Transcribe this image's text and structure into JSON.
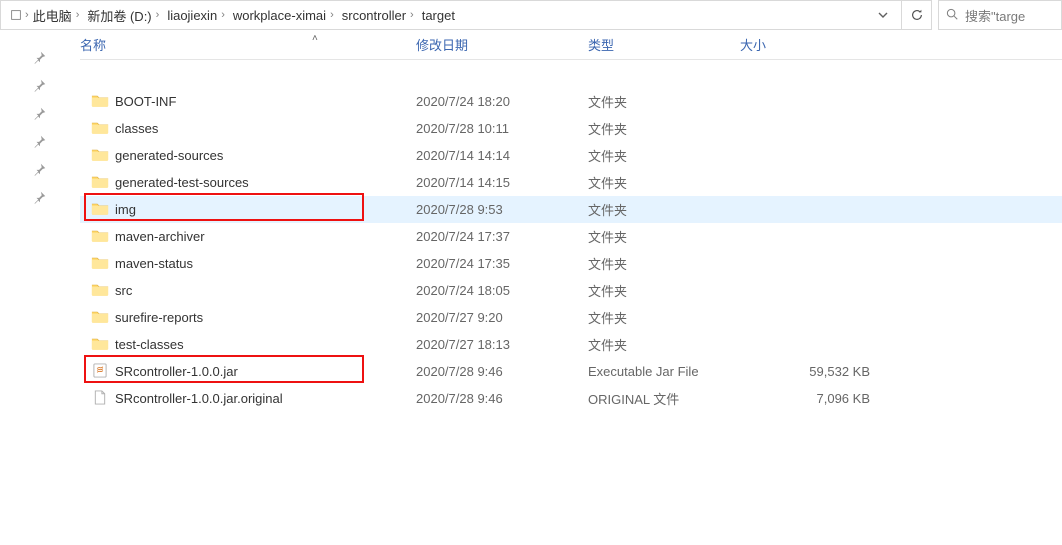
{
  "breadcrumb": {
    "items": [
      {
        "label": "此电脑"
      },
      {
        "label": "新加卷 (D:)"
      },
      {
        "label": "liaojiexin"
      },
      {
        "label": "workplace-ximai"
      },
      {
        "label": "srcontroller"
      },
      {
        "label": "target"
      }
    ]
  },
  "search_prefix": "搜索\"targe",
  "columns": {
    "name": "名称",
    "date": "修改日期",
    "type": "类型",
    "size": "大小"
  },
  "rows": [
    {
      "kind": "folder",
      "name": "BOOT-INF",
      "date": "2020/7/24 18:20",
      "type": "文件夹",
      "size": ""
    },
    {
      "kind": "folder",
      "name": "classes",
      "date": "2020/7/28 10:11",
      "type": "文件夹",
      "size": ""
    },
    {
      "kind": "folder",
      "name": "generated-sources",
      "date": "2020/7/14 14:14",
      "type": "文件夹",
      "size": ""
    },
    {
      "kind": "folder",
      "name": "generated-test-sources",
      "date": "2020/7/14 14:15",
      "type": "文件夹",
      "size": ""
    },
    {
      "kind": "folder",
      "name": "img",
      "date": "2020/7/28 9:53",
      "type": "文件夹",
      "size": "",
      "selected": true
    },
    {
      "kind": "folder",
      "name": "maven-archiver",
      "date": "2020/7/24 17:37",
      "type": "文件夹",
      "size": ""
    },
    {
      "kind": "folder",
      "name": "maven-status",
      "date": "2020/7/24 17:35",
      "type": "文件夹",
      "size": ""
    },
    {
      "kind": "folder",
      "name": "src",
      "date": "2020/7/24 18:05",
      "type": "文件夹",
      "size": ""
    },
    {
      "kind": "folder",
      "name": "surefire-reports",
      "date": "2020/7/27 9:20",
      "type": "文件夹",
      "size": ""
    },
    {
      "kind": "folder",
      "name": "test-classes",
      "date": "2020/7/27 18:13",
      "type": "文件夹",
      "size": ""
    },
    {
      "kind": "jar",
      "name": "SRcontroller-1.0.0.jar",
      "date": "2020/7/28 9:46",
      "type": "Executable Jar File",
      "size": "59,532 KB"
    },
    {
      "kind": "file",
      "name": "SRcontroller-1.0.0.jar.original",
      "date": "2020/7/28 9:46",
      "type": "ORIGINAL 文件",
      "size": "7,096 KB"
    }
  ]
}
